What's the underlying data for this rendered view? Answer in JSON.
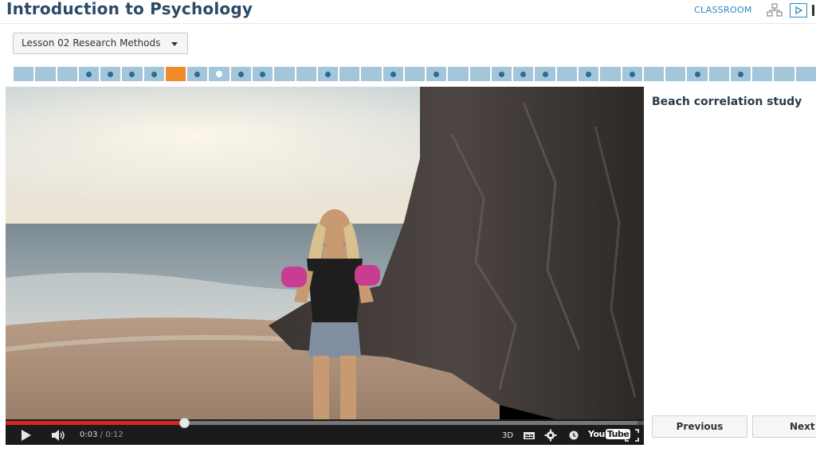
{
  "header": {
    "course_title": "Introduction to Psychology",
    "classroom_label": "CLASSROOM"
  },
  "lesson_select": {
    "selected": "Lesson 02 Research Methods"
  },
  "progress": {
    "segments": [
      {
        "type": "plain"
      },
      {
        "type": "plain"
      },
      {
        "type": "plain"
      },
      {
        "type": "quiz"
      },
      {
        "type": "quiz"
      },
      {
        "type": "quiz"
      },
      {
        "type": "quiz"
      },
      {
        "type": "current"
      },
      {
        "type": "quiz"
      },
      {
        "type": "viewing"
      },
      {
        "type": "quiz"
      },
      {
        "type": "quiz"
      },
      {
        "type": "plain"
      },
      {
        "type": "plain"
      },
      {
        "type": "quiz"
      },
      {
        "type": "plain"
      },
      {
        "type": "plain"
      },
      {
        "type": "quiz"
      },
      {
        "type": "plain"
      },
      {
        "type": "quiz"
      },
      {
        "type": "plain"
      },
      {
        "type": "plain"
      },
      {
        "type": "quiz"
      },
      {
        "type": "quiz"
      },
      {
        "type": "quiz"
      },
      {
        "type": "plain"
      },
      {
        "type": "quiz"
      },
      {
        "type": "plain"
      },
      {
        "type": "quiz"
      },
      {
        "type": "plain"
      },
      {
        "type": "plain"
      },
      {
        "type": "quiz"
      },
      {
        "type": "plain"
      },
      {
        "type": "quiz"
      },
      {
        "type": "plain"
      },
      {
        "type": "plain"
      },
      {
        "type": "plain"
      }
    ],
    "colors": {
      "segment": "#a4c6da",
      "current": "#f08c28",
      "dot": "#2a6b96"
    }
  },
  "video": {
    "time_current": "0:03",
    "time_total": "0:12",
    "played_fraction": 0.28,
    "loaded_fraction": 0.99,
    "label_3d": "3D",
    "logo_you": "You",
    "logo_tube": "Tube"
  },
  "panel": {
    "title": "Beach correlation study"
  },
  "nav": {
    "previous": "Previous",
    "next": "Next"
  }
}
